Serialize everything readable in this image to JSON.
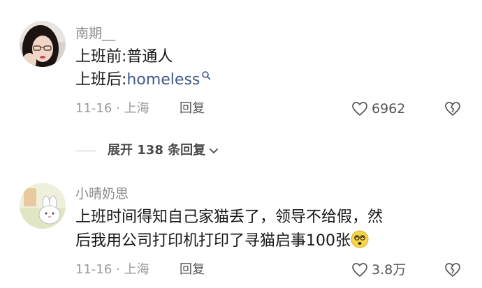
{
  "comments": [
    {
      "username": "南期__",
      "lines": [
        "上班前:普通人",
        "上班后:"
      ],
      "keyword": "homeless",
      "date_location": "11-16 · 上海",
      "reply_label": "回复",
      "likes": "6962",
      "avatar": "woman-portrait"
    },
    {
      "username": "小晴奶思",
      "lines": [
        "上班时间得知自己家猫丢了，领导不给假，然",
        "后我用公司打印机打印了寻猫启事100张"
      ],
      "emoji": "dizzy-face-emoji",
      "date_location": "11-16 · 上海",
      "reply_label": "回复",
      "likes": "3.8万",
      "avatar": "cartoon-bunny"
    }
  ],
  "expand_replies": {
    "label": "展开 138 条回复"
  },
  "colors": {
    "keyword": "#3f5a8a",
    "meta": "#9a9a9a",
    "username": "#8a8a8a"
  }
}
